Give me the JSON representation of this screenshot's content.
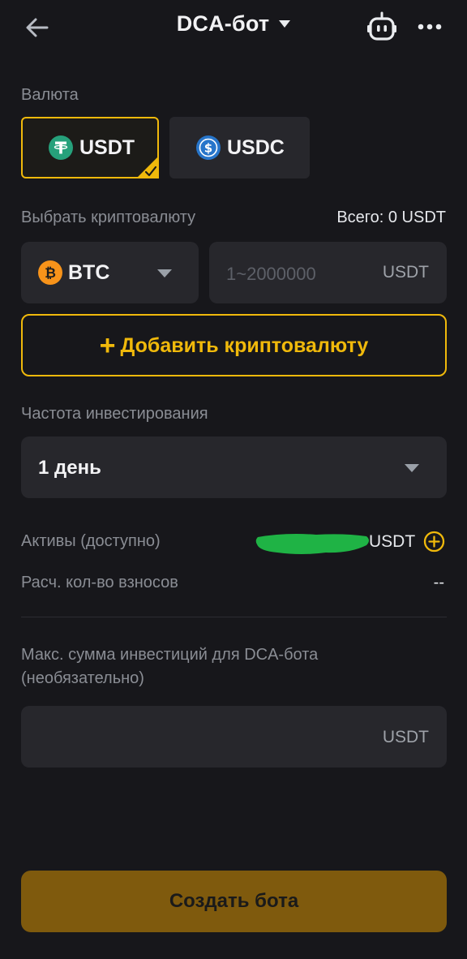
{
  "header": {
    "title": "DCA-бот",
    "back_icon": "arrow-left-icon",
    "robot_icon": "robot-icon",
    "more_icon": "more-dots-icon"
  },
  "currency": {
    "label": "Валюта",
    "options": [
      {
        "name": "USDT",
        "icon": "tether-icon",
        "color": "#26a17b",
        "selected": true
      },
      {
        "name": "USDC",
        "icon": "usdc-icon",
        "color": "#2775ca",
        "selected": false
      }
    ]
  },
  "crypto": {
    "label": "Выбрать криптовалюту",
    "total": "Всего: 0 USDT",
    "coin": "BTC",
    "coin_icon": "bitcoin-icon",
    "coin_color": "#f7931a",
    "amount_placeholder": "1~2000000",
    "amount_unit": "USDT",
    "add_button": "Добавить криптовалюту"
  },
  "frequency": {
    "label": "Частота инвестирования",
    "value": "1 день"
  },
  "assets": {
    "label": "Активы (доступно)",
    "unit": "USDT",
    "add_icon": "plus-circle-icon"
  },
  "contributions": {
    "label": "Расч. кол-во взносов",
    "value": "--"
  },
  "max_investment": {
    "label_line1": "Макс. сумма инвестиций для DCA-бота",
    "label_line2": "(необязательно)",
    "unit": "USDT"
  },
  "create_button": "Создать бота",
  "colors": {
    "accent": "#f0b90b",
    "background": "#17171b",
    "field": "#27272c",
    "create_button": "#7f5a0d",
    "redaction": "#1fb345"
  }
}
